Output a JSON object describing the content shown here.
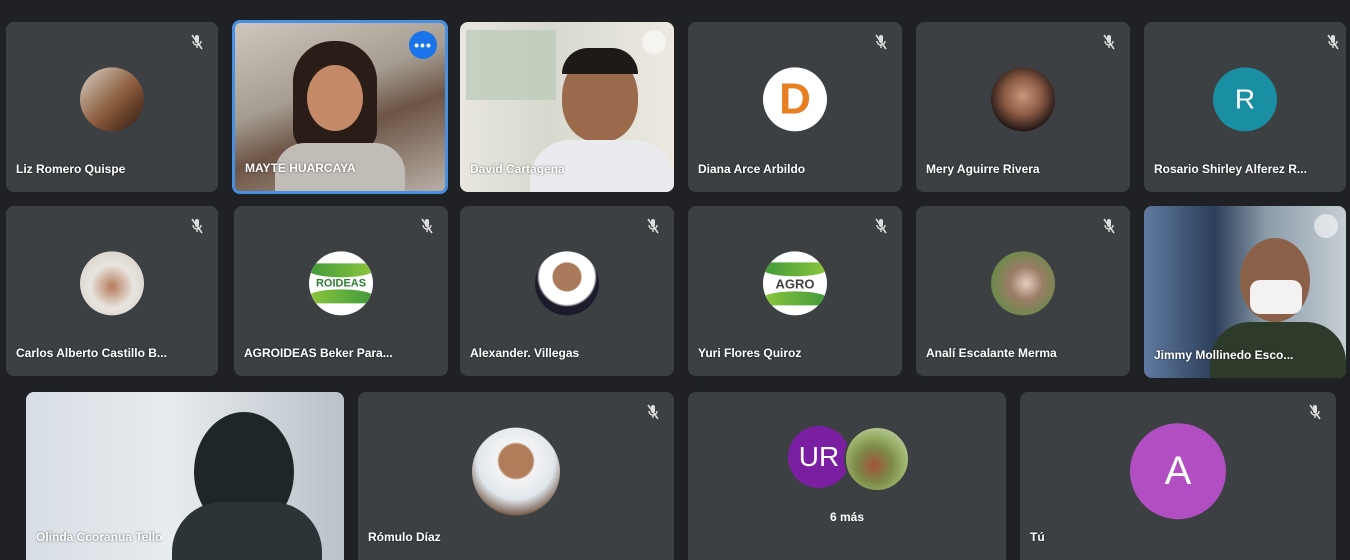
{
  "row1": [
    {
      "name": "Liz Romero Quispe"
    },
    {
      "name": "MAYTE HUARCAYA"
    },
    {
      "name": "David Cartagena"
    },
    {
      "name": "Diana Arce Arbildo",
      "avatar_letter": "D"
    },
    {
      "name": "Mery Aguirre Rivera"
    },
    {
      "name": "Rosario Shirley Alferez R...",
      "avatar_letter": "R"
    }
  ],
  "row2": [
    {
      "name": "Carlos Alberto Castillo B..."
    },
    {
      "name": "AGROIDEAS Beker Para...",
      "logo_text": "ROIDEAS"
    },
    {
      "name": "Alexander. Villegas"
    },
    {
      "name": "Yuri Flores Quiroz",
      "logo_text": "AGRO"
    },
    {
      "name": "Analí Escalante Merma"
    },
    {
      "name": "Jimmy Mollinedo Esco..."
    }
  ],
  "row3": [
    {
      "name": "Olinda Ccoranua Tello"
    },
    {
      "name": "Rómulo Díaz"
    },
    {
      "more_label": "6 más",
      "avatar_letters": "UR"
    },
    {
      "name": "Tú",
      "avatar_letter": "A"
    }
  ],
  "colors": {
    "background": "#202124",
    "tile": "#3c4043",
    "active_border": "#4a90e2",
    "diana_avatar": "#e67e22",
    "rosario_avatar": "#1a8fa3",
    "ur_avatar": "#7b1fa2",
    "tu_avatar": "#b14ec2"
  },
  "icons": {
    "mute": "mic-off-icon",
    "more": "more-options-icon",
    "pin": "pin-icon"
  }
}
